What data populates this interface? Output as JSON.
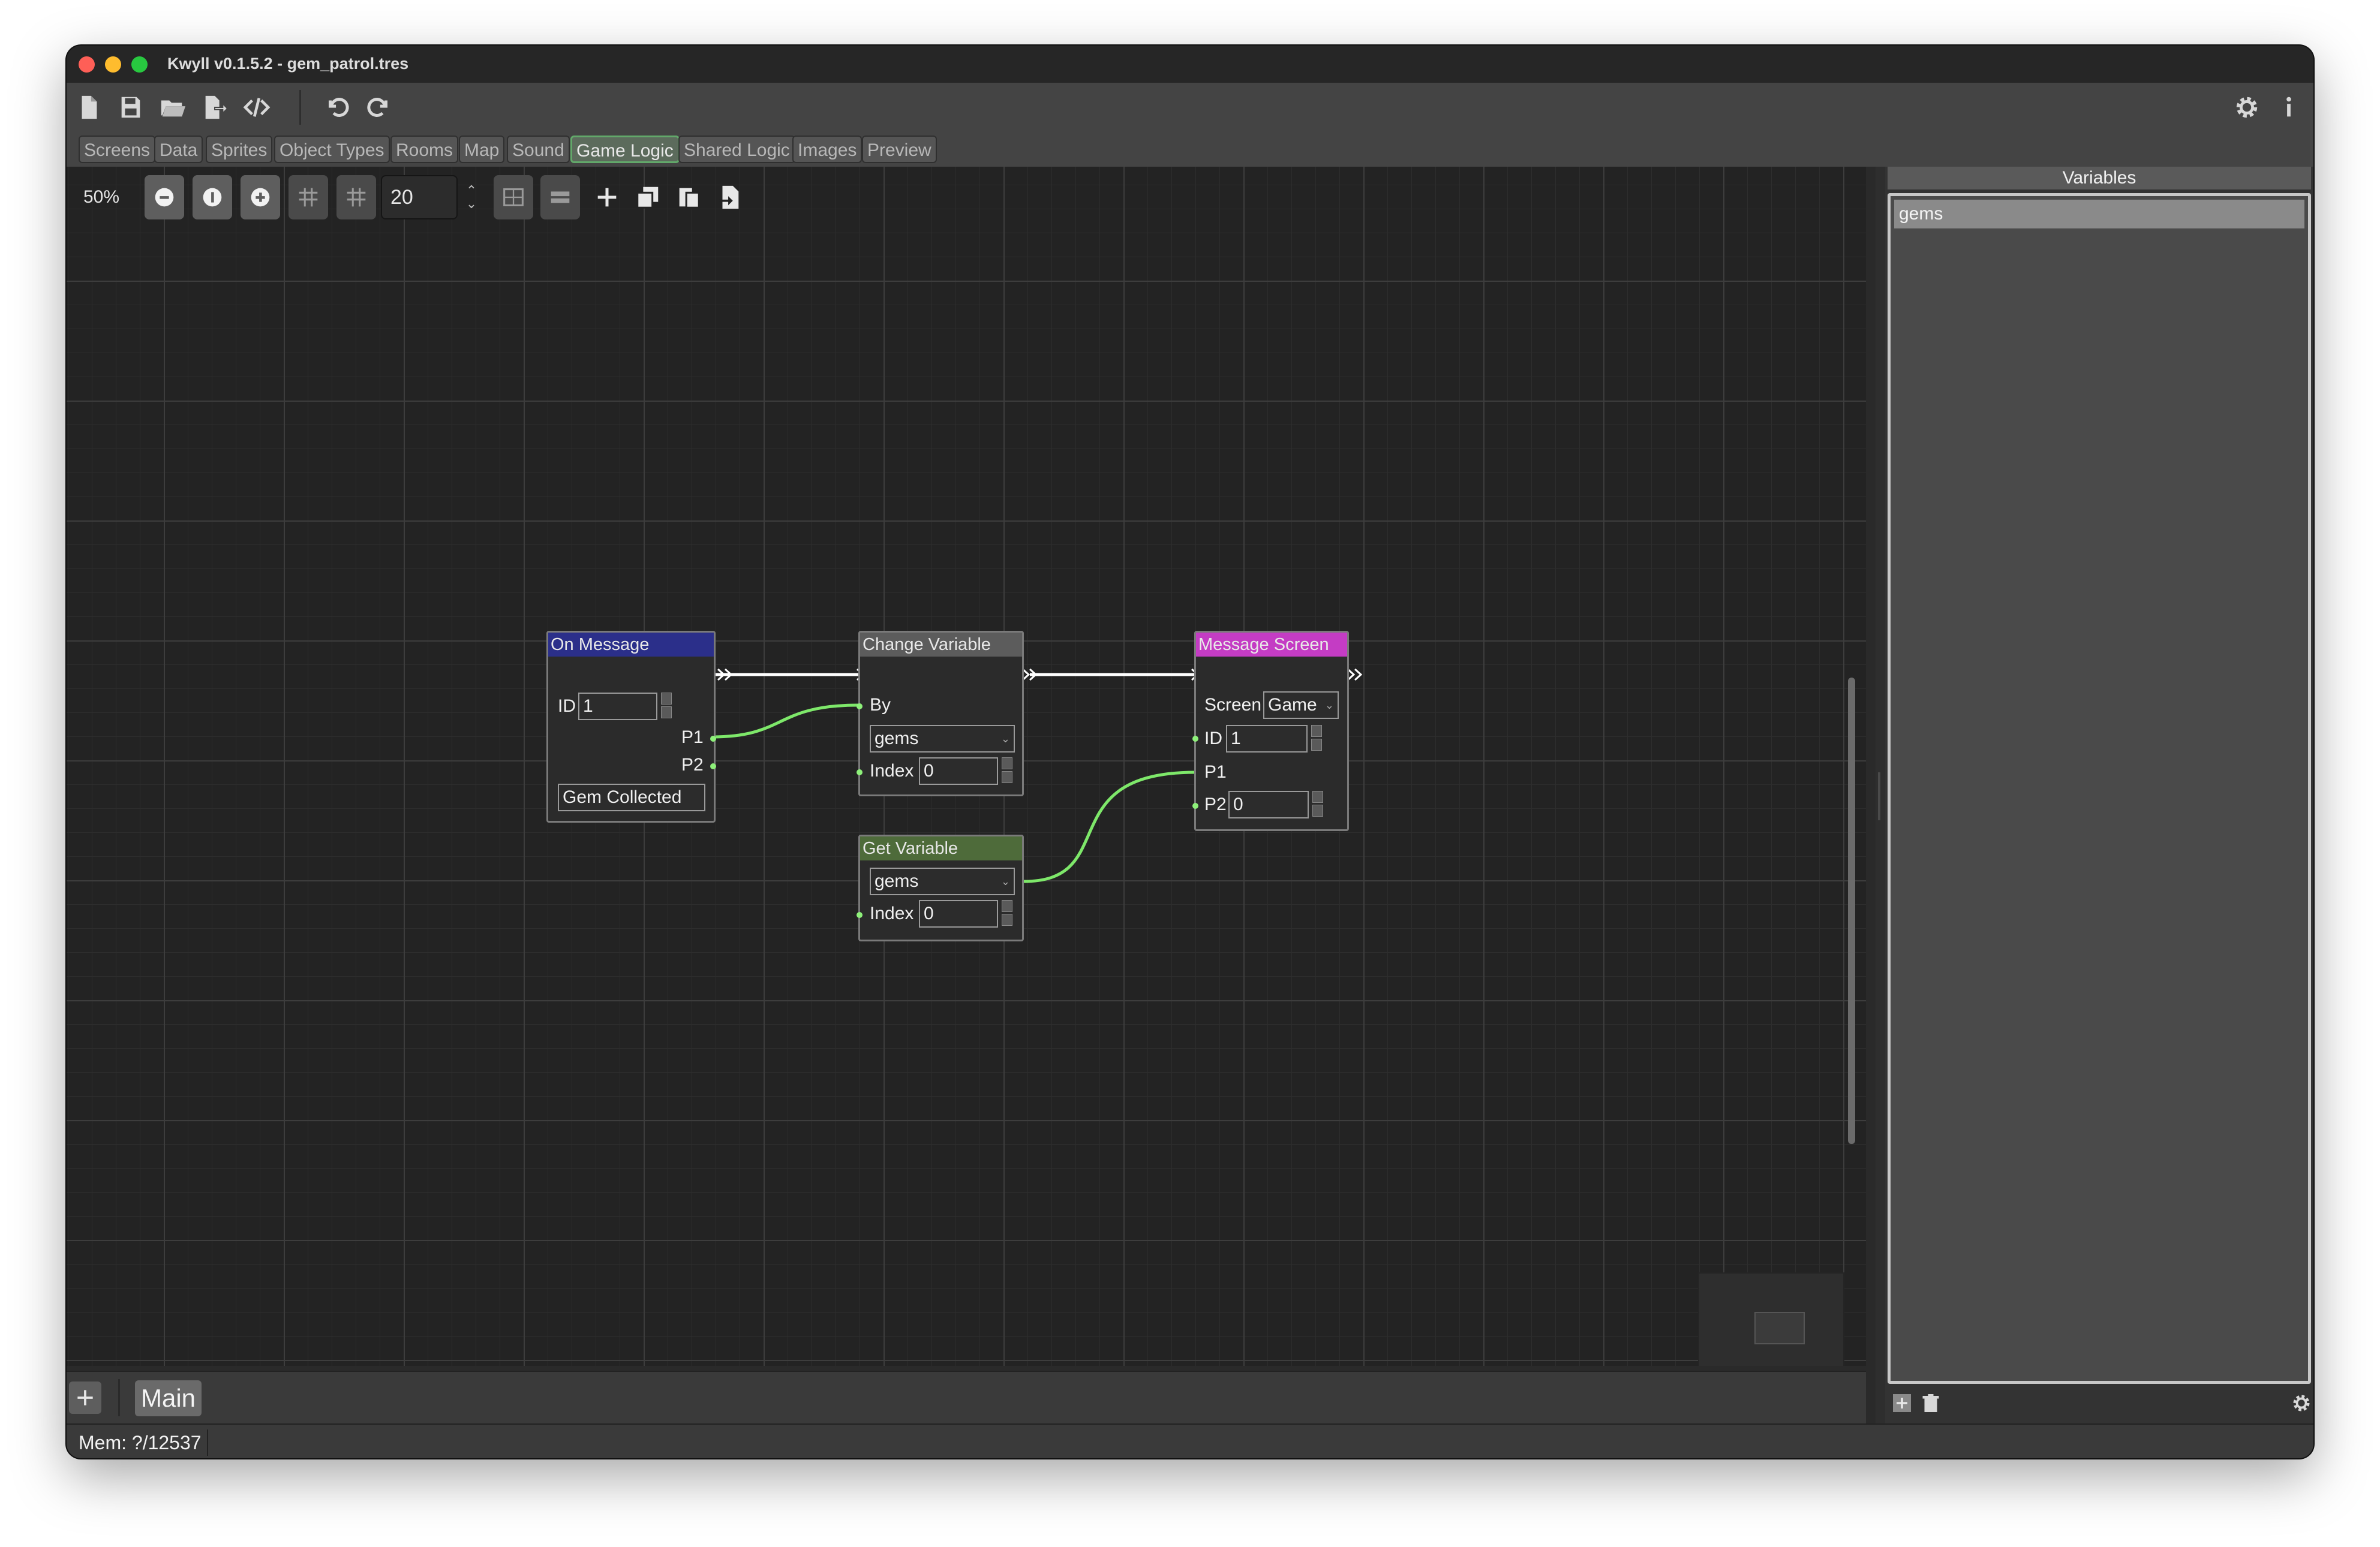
{
  "window": {
    "title": "Kwyll v0.1.5.2 - gem_patrol.tres"
  },
  "toolbar": {
    "buttons": [
      {
        "icon": "new-file-icon"
      },
      {
        "icon": "save-icon"
      },
      {
        "icon": "open-folder-icon"
      },
      {
        "icon": "export-icon"
      },
      {
        "icon": "code-icon"
      },
      {
        "icon": "undo-icon"
      },
      {
        "icon": "redo-icon"
      },
      {
        "icon": "settings-gear-icon"
      },
      {
        "icon": "info-icon"
      }
    ]
  },
  "tabs": [
    {
      "label": "Screens"
    },
    {
      "label": "Data"
    },
    {
      "label": "Sprites"
    },
    {
      "label": "Object Types"
    },
    {
      "label": "Rooms"
    },
    {
      "label": "Map"
    },
    {
      "label": "Sound"
    },
    {
      "label": "Game Logic",
      "active": true
    },
    {
      "label": "Shared Logic"
    },
    {
      "label": "Images"
    },
    {
      "label": "Preview"
    }
  ],
  "graph_toolbar": {
    "zoom": "50%",
    "snap_distance": "20"
  },
  "nodes": {
    "on_message": {
      "title": "On Message",
      "header_color": "#2b2f8a",
      "id_label": "ID",
      "id_value": "1",
      "p1_label": "P1",
      "p2_label": "P2",
      "message_value": "Gem Collected"
    },
    "change_variable": {
      "title": "Change Variable",
      "header_color": "#5c5c5c",
      "by_label": "By",
      "variable_value": "gems",
      "index_label": "Index",
      "index_value": "0"
    },
    "message_screen": {
      "title": "Message Screen",
      "header_color": "#c43cc4",
      "screen_label": "Screen",
      "screen_value": "Game",
      "id_label": "ID",
      "id_value": "1",
      "p1_label": "P1",
      "p2_label": "P2",
      "p2_value": "0"
    },
    "get_variable": {
      "title": "Get Variable",
      "header_color": "#4e6b3a",
      "variable_value": "gems",
      "index_label": "Index",
      "index_value": "0"
    }
  },
  "graph_tabs": {
    "main_label": "Main"
  },
  "status": {
    "memory": "Mem: ?/12537"
  },
  "variables_panel": {
    "title": "Variables",
    "items": [
      {
        "name": "gems",
        "selected": true
      }
    ]
  },
  "colors": {
    "accent": "#62a86a",
    "connection_data": "#7ee86a",
    "connection_flow": "#ffffff"
  }
}
